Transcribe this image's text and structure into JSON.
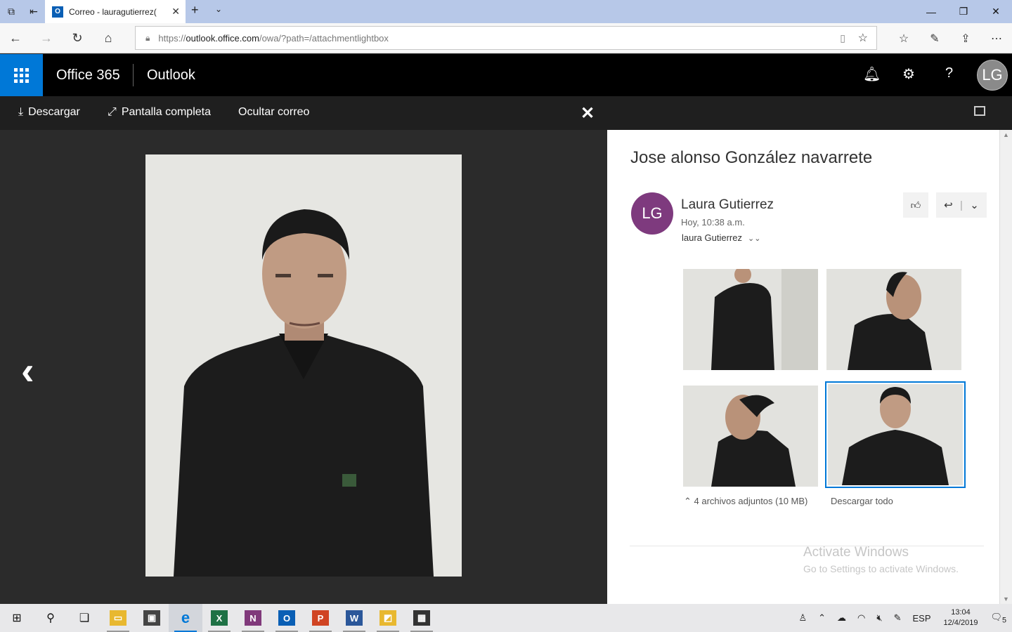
{
  "browser": {
    "tab_title": "Correo - lauragutierrez(",
    "tab_icon": "O",
    "url_scheme": "https://",
    "url_domain": "outlook.office.com",
    "url_path": "/owa/?path=/attachmentlightbox"
  },
  "suite": {
    "brand": "Office 365",
    "app": "Outlook",
    "avatar_initials": "LG",
    "help_label": "?"
  },
  "commands": {
    "download": "Descargar",
    "fullscreen": "Pantalla completa",
    "hide_mail": "Ocultar correo"
  },
  "message": {
    "subject": "Jose alonso González navarrete",
    "sender_initials": "LG",
    "sender": "Laura Gutierrez",
    "time": "Hoy, 10:38 a.m.",
    "to": "laura Gutierrez",
    "attachments_info": "4 archivos adjuntos (10 MB)",
    "download_all": "Descargar todo"
  },
  "watermark": {
    "line1": "Activate Windows",
    "line2": "Go to Settings to activate Windows."
  },
  "taskbar": {
    "apps": [
      "start",
      "search",
      "task-view",
      "file-explorer",
      "store",
      "edge",
      "excel",
      "onenote",
      "outlook",
      "powerpoint",
      "word",
      "file-manager",
      "calculator"
    ],
    "lang": "ESP",
    "time": "13:04",
    "date": "12/4/2019",
    "notifications": "5"
  },
  "colors": {
    "accent": "#0078d7",
    "sender_avatar": "#7e3a7e"
  }
}
